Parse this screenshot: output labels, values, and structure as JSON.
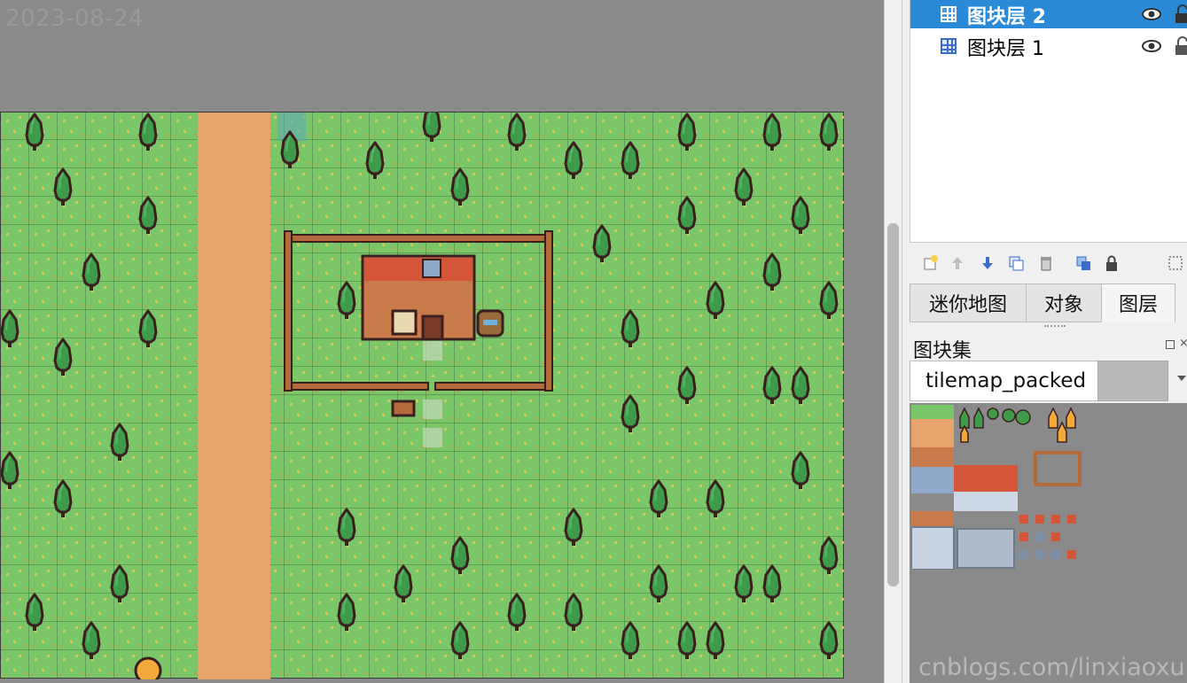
{
  "watermark_date": "2023-08-24",
  "watermark_site": "cnblogs.com/linxiaoxu",
  "colors": {
    "grass": "#7cc66a",
    "dirt_path": "#e8a56b",
    "tree_leaf": "#3f9b49",
    "tree_outline": "#3a1f1f",
    "fence": "#b46a3c",
    "roof": "#d4553a",
    "wall": "#c97a4a",
    "selection": "#2b8ad8"
  },
  "layers_panel": {
    "layers": [
      {
        "name": "图块层 2",
        "selected": true,
        "icon": "tile-layer-icon"
      },
      {
        "name": "图块层 1",
        "selected": false,
        "icon": "tile-layer-icon"
      }
    ]
  },
  "layer_toolbar": {
    "buttons": [
      "new-layer-icon",
      "raise-layer-icon",
      "lower-layer-icon",
      "duplicate-layer-icon",
      "delete-layer-icon",
      "show-hide-others-icon",
      "lock-layer-icon",
      "more-icon"
    ]
  },
  "dock_tabs": {
    "tabs": [
      {
        "label": "迷你地图",
        "active": false
      },
      {
        "label": "对象",
        "active": false
      },
      {
        "label": "图层",
        "active": true
      }
    ]
  },
  "tilesets_panel": {
    "title": "图块集",
    "selected_tileset": "tilemap_packed"
  }
}
